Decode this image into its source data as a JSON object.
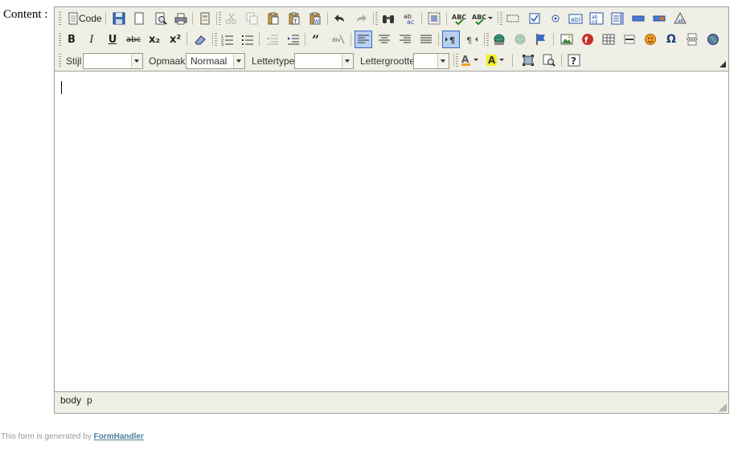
{
  "form": {
    "field_label": "Content :"
  },
  "toolbar": {
    "code_label": "Code",
    "bold_glyph": "B",
    "italic_glyph": "I",
    "underline_glyph": "U",
    "strike_glyph": "abc",
    "sub_glyph": "x₂",
    "sup_glyph": "x²",
    "style_label": "Stijl",
    "style_value": "",
    "format_label": "Opmaak",
    "format_value": "Normaal",
    "font_label": "Lettertype",
    "font_value": "",
    "size_label": "Lettergrootte",
    "size_value": ""
  },
  "statusbar": {
    "path": [
      "body",
      "p"
    ]
  },
  "footer": {
    "prefix": "This form is generated by",
    "link_text": "FormHandler"
  },
  "colors": {
    "chrome": "#f0efe5",
    "active_button": "#b8d0f0",
    "footer_link": "#4f7e9a"
  }
}
